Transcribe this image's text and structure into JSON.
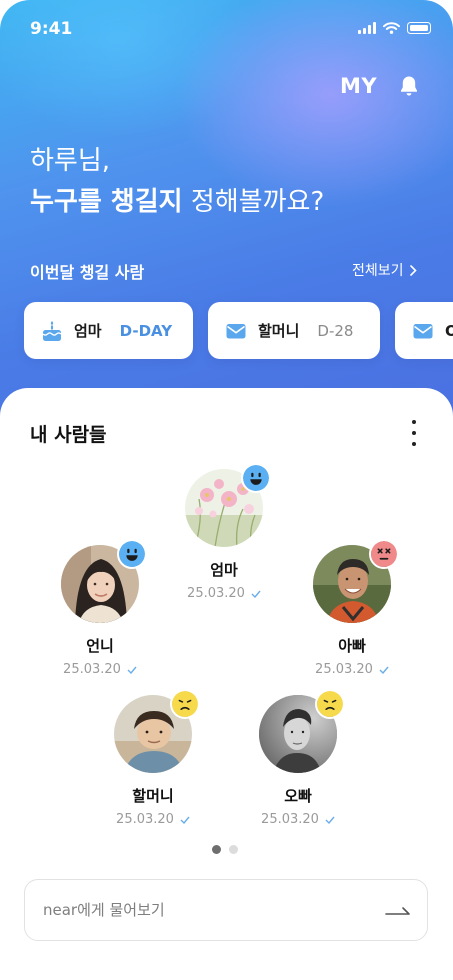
{
  "status_bar": {
    "time": "9:41"
  },
  "header": {
    "my_label": "MY",
    "bell_icon": "bell-icon"
  },
  "greeting": {
    "line1": "하루님,",
    "line2_bold": "누구를 챙길지",
    "line2_rest": " 정해볼까요?"
  },
  "upcoming": {
    "title": "이번달 챙길 사람",
    "see_all": "전체보기",
    "cards": [
      {
        "icon": "cake-icon",
        "name": "엄마",
        "dday": "D-DAY"
      },
      {
        "icon": "mail-icon",
        "name": "할머니",
        "dday": "D-28"
      },
      {
        "icon": "mail-icon",
        "name": "O",
        "dday": ""
      }
    ]
  },
  "people": {
    "title": "내 사람들",
    "list": [
      {
        "name": "엄마",
        "date": "25.03.20",
        "mood": "happy"
      },
      {
        "name": "언니",
        "date": "25.03.20",
        "mood": "happy"
      },
      {
        "name": "아빠",
        "date": "25.03.20",
        "mood": "dizzy"
      },
      {
        "name": "할머니",
        "date": "25.03.20",
        "mood": "sad"
      },
      {
        "name": "오빠",
        "date": "25.03.20",
        "mood": "sad"
      }
    ],
    "page_count": 2,
    "active_page": 1
  },
  "ask": {
    "placeholder": "near에게 물어보기"
  },
  "colors": {
    "accent": "#4a90e2",
    "mood_happy": "#5ab0f2",
    "mood_sad": "#f7d94c",
    "mood_dizzy": "#f08a8a"
  }
}
